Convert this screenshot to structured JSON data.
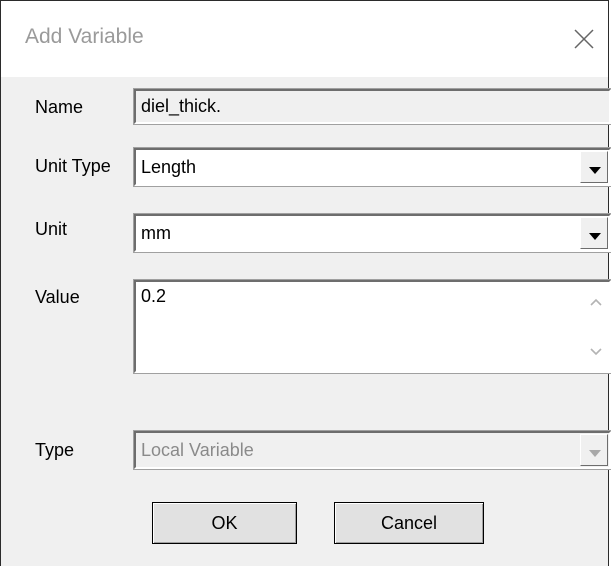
{
  "dialog": {
    "title": "Add Variable"
  },
  "form": {
    "name_label": "Name",
    "name_value": "diel_thick.",
    "unit_type_label": "Unit Type",
    "unit_type_value": "Length",
    "unit_label": "Unit",
    "unit_value": "mm",
    "value_label": "Value",
    "value_value": "0.2",
    "type_label": "Type",
    "type_value": "Local Variable"
  },
  "buttons": {
    "ok_label": "OK",
    "cancel_label": "Cancel"
  },
  "icons": {
    "close": "close-icon",
    "dropdown": "chevron-down-icon",
    "scroll_up": "chevron-up-icon",
    "scroll_down": "chevron-down-icon"
  }
}
